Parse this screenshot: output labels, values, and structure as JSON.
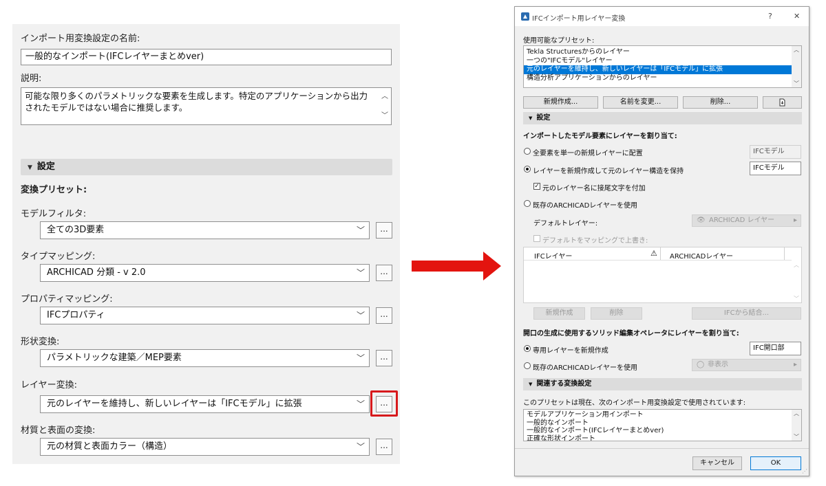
{
  "left_panel": {
    "name_label": "インポート用変換設定の名前:",
    "name_value": "一般的なインポート(IFCレイヤーまとめver)",
    "desc_label": "説明:",
    "desc_value": "可能な限り多くのパラメトリックな要素を生成します。特定のアプリケーションから出力されたモデルではない場合に推奨します。",
    "section_title": "設定",
    "presets_title": "変換プリセット:",
    "rows": [
      {
        "label": "モデルフィルタ:",
        "value": "全ての3D要素"
      },
      {
        "label": "タイプマッピング:",
        "value": "ARCHICAD 分類 - v 2.0"
      },
      {
        "label": "プロパティマッピング:",
        "value": "IFCプロパティ"
      },
      {
        "label": "形状変換:",
        "value": "パラメトリックな建築／MEP要素"
      },
      {
        "label": "レイヤー変換:",
        "value": "元のレイヤーを維持し、新しいレイヤーは「IFCモデル」に拡張"
      },
      {
        "label": "材質と表面の変換:",
        "value": "元の材質と表面カラー（構造）"
      }
    ],
    "dots_label": "...",
    "highlight_color": "#d7191c"
  },
  "arrow_color": "#e3140f",
  "dialog": {
    "title": "IFCインポート用レイヤー変換",
    "help": "?",
    "close": "✕",
    "presets_label": "使用可能なプリセット:",
    "presets": [
      "Tekla Structuresからのレイヤー",
      "一つの\"IFCモデル\"レイヤー",
      "元のレイヤーを維持し、新しいレイヤーは「IFCモデル」に拡張",
      "構造分析アプリケーションからのレイヤー"
    ],
    "selected_preset_index": 2,
    "btn_new": "新規作成...",
    "btn_rename": "名前を変更...",
    "btn_delete": "削除...",
    "section_settings": "設定",
    "assign_title": "インポートしたモデル要素にレイヤーを割り当て:",
    "opt_single": "全要素を単一の新規レイヤーに配置",
    "opt_single_value": "IFCモデル",
    "opt_keep": "レイヤーを新規作成して元のレイヤー構造を保持",
    "opt_keep_value": "IFCモデル",
    "chk_suffix": "元のレイヤー名に接尾文字を付加",
    "opt_existing": "既存のARCHICADレイヤーを使用",
    "default_layer_label": "デフォルトレイヤー:",
    "default_layer_value": "ARCHICAD レイヤー",
    "chk_override": "デフォルトをマッピングで上書き:",
    "col_ifc": "IFCレイヤー",
    "col_archicad": "ARCHICADレイヤー",
    "btn_map_new": "新規作成",
    "btn_map_delete": "削除",
    "btn_merge": "IFCから結合...",
    "opening_title": "開口の生成に使用するソリッド編集オペレータにレイヤーを割り当て:",
    "opt_dedicated": "専用レイヤーを新規作成",
    "opt_dedicated_value": "IFC開口部",
    "opt_existing2": "既存のARCHICADレイヤーを使用",
    "hidden_value": "非表示",
    "section_related": "関連する変換設定",
    "related_desc": "このプリセットは現在、次のインポート用変換設定で使用されています:",
    "related_list": [
      "モデルアプリケーション用インポート",
      "一般的なインポート",
      "一般的なインポート(IFCレイヤーまとめver)",
      "正確な形状インポート"
    ],
    "cancel": "キャンセル",
    "ok": "OK"
  }
}
